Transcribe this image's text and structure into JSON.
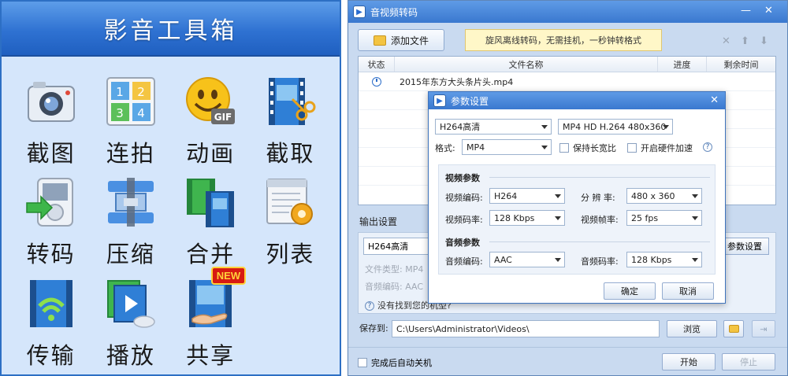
{
  "toolbox": {
    "title": "影音工具箱",
    "tools": [
      {
        "label": "截图",
        "icon": "camera-icon"
      },
      {
        "label": "连拍",
        "icon": "grid-photo-icon"
      },
      {
        "label": "动画",
        "icon": "gif-smiley-icon"
      },
      {
        "label": "截取",
        "icon": "film-scissors-icon"
      },
      {
        "label": "转码",
        "icon": "player-arrow-icon"
      },
      {
        "label": "压缩",
        "icon": "compress-icon"
      },
      {
        "label": "合并",
        "icon": "merge-icon"
      },
      {
        "label": "列表",
        "icon": "list-gear-icon"
      },
      {
        "label": "传输",
        "icon": "wifi-film-icon"
      },
      {
        "label": "播放",
        "icon": "play-film-icon"
      },
      {
        "label": "共享",
        "icon": "share-film-icon",
        "badge": "NEW"
      }
    ]
  },
  "converter": {
    "title": "音视频转码",
    "add_file": "添加文件",
    "tip": "旋风离线转码，无需挂机，一秒钟转格式",
    "columns": [
      "状态",
      "文件名称",
      "进度",
      "剩余时间"
    ],
    "files": [
      {
        "name": "2015年东方大头条片头.mp4"
      }
    ],
    "output_label": "输出设置",
    "preset": "H264高清",
    "file_type_label": "文件类型:",
    "file_type_value": "MP4",
    "audio_codec_label": "音频编码:",
    "audio_codec_value": "AAC",
    "param_button": "参数设置",
    "hint": "没有找到您的机型?",
    "save_to_label": "保存到:",
    "save_path": "C:\\Users\\Administrator\\Videos\\",
    "browse": "浏览",
    "auto_shutdown": "完成后自动关机",
    "start": "开始",
    "stop": "停止"
  },
  "dialog": {
    "title": "参数设置",
    "preset": "H264高清",
    "profile": "MP4 HD H.264 480x360",
    "format_label": "格式:",
    "format_value": "MP4",
    "keep_ratio": "保持长宽比",
    "hw_accel": "开启硬件加速",
    "video_section": "视频参数",
    "video_codec_label": "视频编码:",
    "video_codec": "H264",
    "resolution_label": "分 辨 率:",
    "resolution": "480 x 360",
    "video_bitrate_label": "视频码率:",
    "video_bitrate": "128 Kbps",
    "framerate_label": "视频帧率:",
    "framerate": "25 fps",
    "audio_section": "音频参数",
    "audio_codec_label": "音频编码:",
    "audio_codec": "AAC",
    "audio_bitrate_label": "音频码率:",
    "audio_bitrate": "128 Kbps",
    "ok": "确定",
    "cancel": "取消"
  },
  "colors": {
    "accent": "#2f72d2",
    "title_text": "#ffffff",
    "tip_bg": "#fff7c8",
    "badge": "#d71b12"
  }
}
